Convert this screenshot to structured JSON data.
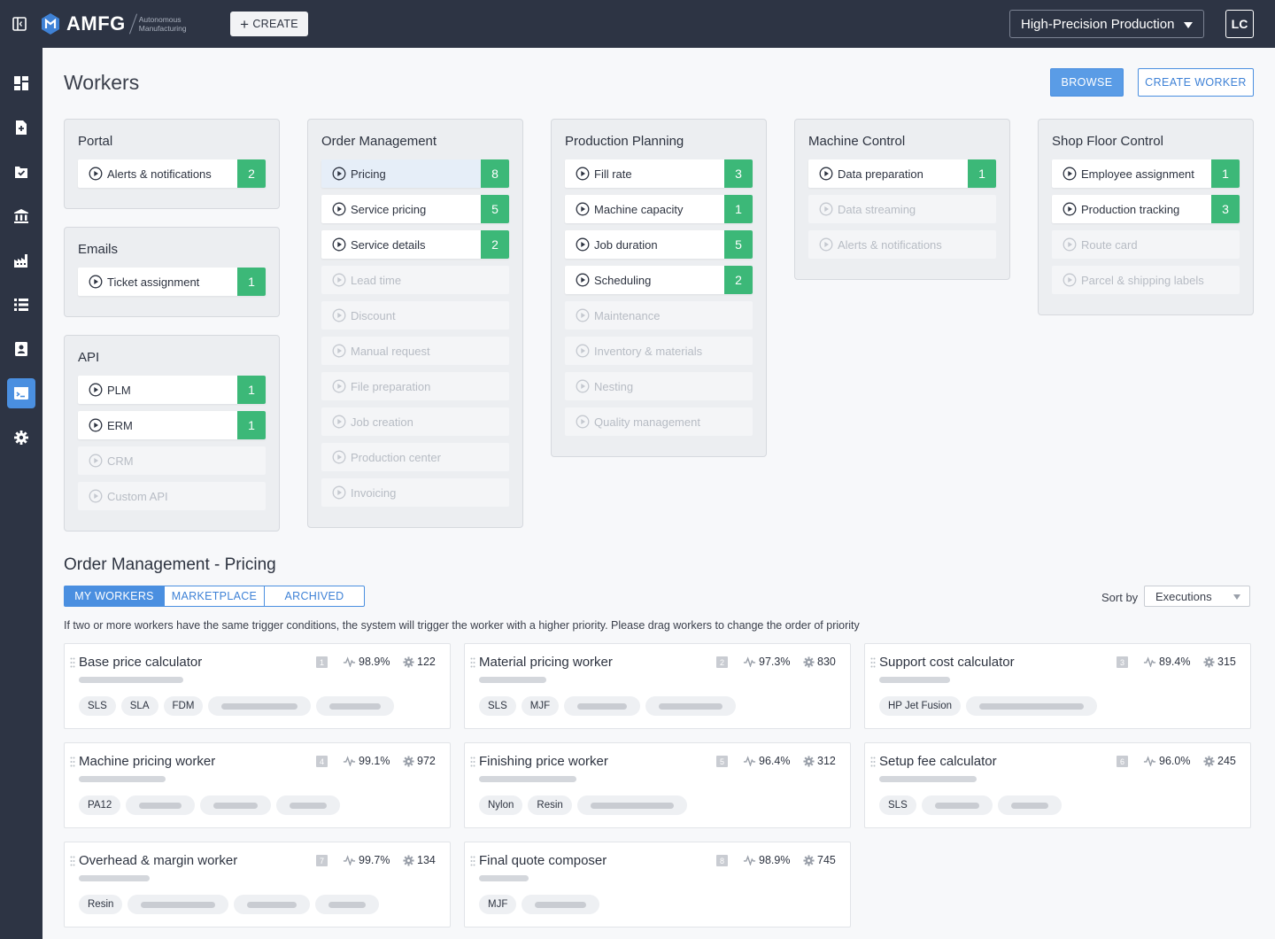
{
  "header": {
    "logo_text": "AMFG",
    "logo_sub_1": "Autonomous",
    "logo_sub_2": "Manufacturing",
    "create_label": "CREATE",
    "workspace": "High-Precision Production",
    "avatar_initials": "LC"
  },
  "sidebar": {
    "items": [
      {
        "icon": "dashboard-icon"
      },
      {
        "icon": "add-document-icon"
      },
      {
        "icon": "inbox-check-icon"
      },
      {
        "icon": "bank-icon"
      },
      {
        "icon": "factory-icon"
      },
      {
        "icon": "list-icon"
      },
      {
        "icon": "contacts-icon"
      },
      {
        "icon": "terminal-workers-icon",
        "active": true
      },
      {
        "icon": "settings-gear-icon"
      }
    ]
  },
  "page": {
    "title": "Workers",
    "browse_label": "BROWSE",
    "create_worker_label": "CREATE WORKER"
  },
  "groups": {
    "portal": {
      "title": "Portal",
      "items": [
        {
          "label": "Alerts & notifications",
          "count": "2"
        }
      ]
    },
    "emails": {
      "title": "Emails",
      "items": [
        {
          "label": "Ticket assignment",
          "count": "1"
        }
      ]
    },
    "api": {
      "title": "API",
      "items": [
        {
          "label": "PLM",
          "count": "1"
        },
        {
          "label": "ERM",
          "count": "1"
        },
        {
          "label": "CRM"
        },
        {
          "label": "Custom API"
        }
      ]
    },
    "order_management": {
      "title": "Order Management",
      "items": [
        {
          "label": "Pricing",
          "count": "8",
          "selected": true
        },
        {
          "label": "Service pricing",
          "count": "5"
        },
        {
          "label": "Service details",
          "count": "2"
        },
        {
          "label": "Lead time"
        },
        {
          "label": "Discount"
        },
        {
          "label": "Manual request"
        },
        {
          "label": "File preparation"
        },
        {
          "label": "Job creation"
        },
        {
          "label": "Production center"
        },
        {
          "label": "Invoicing"
        }
      ]
    },
    "production_planning": {
      "title": "Production Planning",
      "items": [
        {
          "label": "Fill rate",
          "count": "3"
        },
        {
          "label": "Machine capacity",
          "count": "1"
        },
        {
          "label": "Job duration",
          "count": "5"
        },
        {
          "label": "Scheduling",
          "count": "2"
        },
        {
          "label": "Maintenance"
        },
        {
          "label": "Inventory & materials"
        },
        {
          "label": "Nesting"
        },
        {
          "label": "Quality management"
        }
      ]
    },
    "machine_control": {
      "title": "Machine Control",
      "items": [
        {
          "label": "Data preparation",
          "count": "1"
        },
        {
          "label": "Data streaming"
        },
        {
          "label": "Alerts & notifications"
        }
      ]
    },
    "shop_floor_control": {
      "title": "Shop Floor Control",
      "items": [
        {
          "label": "Employee assignment",
          "count": "1"
        },
        {
          "label": "Production tracking",
          "count": "3"
        },
        {
          "label": "Route card"
        },
        {
          "label": "Parcel & shipping labels"
        }
      ]
    }
  },
  "workers_section": {
    "title": "Order Management - Pricing",
    "tabs": [
      "MY WORKERS",
      "MARKETPLACE",
      "ARCHIVED"
    ],
    "active_tab": "MY WORKERS",
    "sort_label": "Sort by",
    "sort_value": "Executions",
    "hint": "If two or more workers have the same trigger conditions, the system will trigger the worker with a higher priority. Please drag workers to change the order of priority",
    "cards": [
      {
        "name": "Base price calculator",
        "priority": "1",
        "success_rate": "98.9%",
        "executions": "122",
        "tags": [
          "SLS",
          "SLA",
          "FDM"
        ]
      },
      {
        "name": "Material pricing worker",
        "priority": "2",
        "success_rate": "97.3%",
        "executions": "830",
        "tags": [
          "SLS",
          "MJF"
        ]
      },
      {
        "name": "Support cost calculator",
        "priority": "3",
        "success_rate": "89.4%",
        "executions": "315",
        "tags": [
          "HP Jet Fusion"
        ]
      },
      {
        "name": "Machine pricing worker",
        "priority": "4",
        "success_rate": "99.1%",
        "executions": "972",
        "tags": [
          "PA12"
        ]
      },
      {
        "name": "Finishing price worker",
        "priority": "5",
        "success_rate": "96.4%",
        "executions": "312",
        "tags": [
          "Nylon",
          "Resin"
        ]
      },
      {
        "name": "Setup fee calculator",
        "priority": "6",
        "success_rate": "96.0%",
        "executions": "245",
        "tags": [
          "SLS"
        ]
      },
      {
        "name": "Overhead & margin worker",
        "priority": "7",
        "success_rate": "99.7%",
        "executions": "134",
        "tags": [
          "Resin"
        ]
      },
      {
        "name": "Final quote composer",
        "priority": "8",
        "success_rate": "98.9%",
        "executions": "745",
        "tags": [
          "MJF"
        ]
      }
    ]
  },
  "colors": {
    "nav_bg": "#2d3444",
    "accent": "#4a8fe0",
    "count_green": "#3cb878"
  }
}
